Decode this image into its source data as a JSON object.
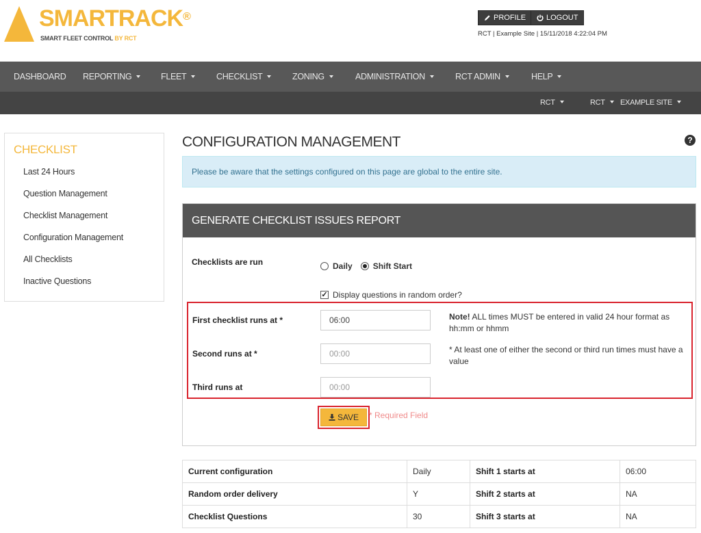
{
  "header": {
    "brand": "SMARTRACK",
    "brand_mark": "®",
    "tagline_main": "SMART FLEET CONTROL",
    "tagline_by": "BY RCT",
    "profile_label": "PROFILE",
    "logout_label": "LOGOUT",
    "session_info": "RCT | Example Site | 15/11/2018 4:22:04 PM"
  },
  "nav": {
    "primary": [
      {
        "label": "DASHBOARD",
        "dropdown": false
      },
      {
        "label": "REPORTING",
        "dropdown": true
      },
      {
        "label": "FLEET",
        "dropdown": true
      },
      {
        "label": "CHECKLIST",
        "dropdown": true
      },
      {
        "label": "ZONING",
        "dropdown": true
      },
      {
        "label": "ADMINISTRATION",
        "dropdown": true
      },
      {
        "label": "RCT ADMIN",
        "dropdown": true
      },
      {
        "label": "HELP",
        "dropdown": true
      }
    ],
    "secondary": [
      {
        "label": "RCT",
        "dropdown": true
      },
      {
        "label": "RCT",
        "dropdown": true
      },
      {
        "label": "EXAMPLE SITE",
        "dropdown": true
      }
    ]
  },
  "sidebar": {
    "title": "CHECKLIST",
    "items": [
      {
        "label": "Last 24 Hours"
      },
      {
        "label": "Question Management"
      },
      {
        "label": "Checklist Management"
      },
      {
        "label": "Configuration Management"
      },
      {
        "label": "All Checklists"
      },
      {
        "label": "Inactive Questions"
      }
    ]
  },
  "main": {
    "title": "CONFIGURATION MANAGEMENT",
    "help_glyph": "?",
    "alert": "Please be aware that the settings configured on this page are global to the entire site.",
    "panel": {
      "title": "GENERATE CHECKLIST ISSUES REPORT",
      "run_label": "Checklists are run",
      "run_options": [
        {
          "label": "Daily",
          "selected": false
        },
        {
          "label": "Shift Start",
          "selected": true
        }
      ],
      "random_order_label": "Display questions in random order?",
      "random_order_checked": true,
      "first_label": "First checklist runs at *",
      "first_value": "06:00",
      "second_label": "Second runs at *",
      "second_placeholder": "00:00",
      "third_label": "Third runs at",
      "third_placeholder": "00:00",
      "note_bold": "Note!",
      "note_text": " ALL times MUST be entered in valid 24 hour format as hh:mm or hhmm",
      "note2": "* At least one of either the second or third run times must have a value",
      "save_label": "SAVE",
      "required_label": "* Required Field"
    },
    "config_table": [
      {
        "label": "Current configuration",
        "value": "Daily",
        "shift_label": "Shift 1 starts at",
        "shift_value": "06:00"
      },
      {
        "label": "Random order delivery",
        "value": "Y",
        "shift_label": "Shift 2 starts at",
        "shift_value": "NA"
      },
      {
        "label": "Checklist Questions",
        "value": "30",
        "shift_label": "Shift 3 starts at",
        "shift_value": "NA"
      }
    ]
  },
  "colors": {
    "brand": "#f4b73b",
    "nav_primary": "#585858",
    "nav_secondary": "#444444",
    "alert_bg": "#d9edf7",
    "highlight_border": "#d9232d"
  }
}
